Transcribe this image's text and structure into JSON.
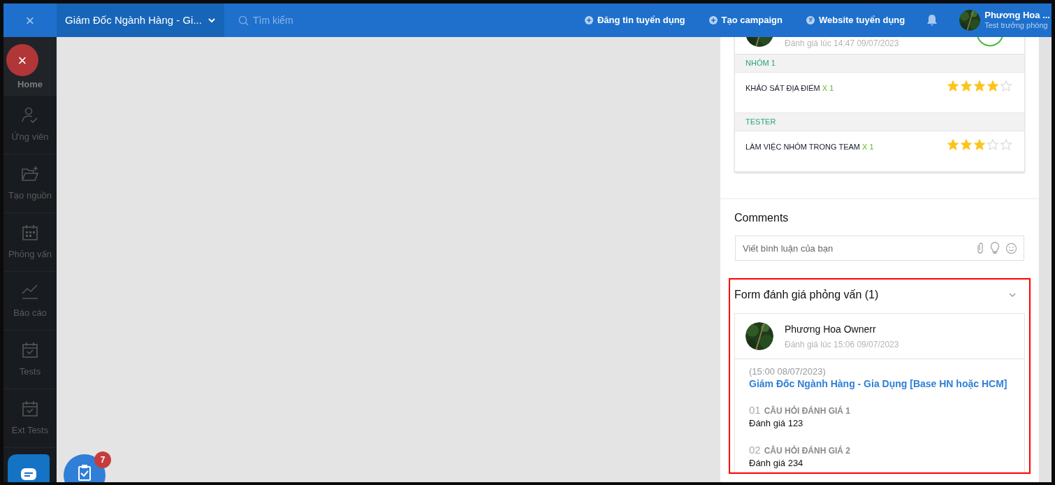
{
  "topbar": {
    "close": "×",
    "job_title": "Giám Đốc Ngành Hàng - Gi...",
    "search": {
      "placeholder": "Tìm kiếm"
    },
    "actions": [
      {
        "label": "Đăng tin tuyển dụng",
        "kind": "plus"
      },
      {
        "label": "Tạo campaign",
        "kind": "plus"
      },
      {
        "label": "Website tuyển dụng",
        "kind": "globe"
      }
    ],
    "user": {
      "name": "Phương Hoa ...",
      "role": "Test trưởng phòng"
    }
  },
  "sidebar": {
    "items": [
      {
        "label": "Home",
        "selected": true
      },
      {
        "label": "Ứng viên",
        "selected": false
      },
      {
        "label": "Tạo nguồn",
        "selected": false
      },
      {
        "label": "Phỏng vấn",
        "selected": false
      },
      {
        "label": "Báo cáo",
        "selected": false
      },
      {
        "label": "Tests",
        "selected": false
      },
      {
        "label": "Ext Tests",
        "selected": false
      }
    ]
  },
  "close_fab": "×",
  "task_badge": "7",
  "review_card": {
    "date": "Đánh giá lúc 14:47 09/07/2023",
    "groups": [
      {
        "name": "NHÓM 1",
        "criteria": [
          {
            "label": "KHẢO SÁT ĐỊA ĐIỂM",
            "weight": "X 1",
            "stars": 4
          }
        ]
      },
      {
        "name": "TESTER",
        "criteria": [
          {
            "label": "LÀM VIỆC NHÓM TRONG TEAM",
            "weight": "X 1",
            "stars": 3
          }
        ]
      }
    ]
  },
  "comments": {
    "title": "Comments",
    "placeholder": "Viết bình luận của bạn"
  },
  "interview_forms": {
    "title": "Form đánh giá phỏng vấn (1)",
    "expanded": true,
    "reviewer": "Phương Hoa Ownerr",
    "reviewed_at": "Đánh giá lúc 15:06 09/07/2023",
    "interview_time": "(15:00 08/07/2023)",
    "job_link": "Giám Đốc Ngành Hàng - Gia Dụng [Base HN hoặc HCM]",
    "questions": [
      {
        "number": "01",
        "title": "CÂU HỎI ĐÁNH GIÁ 1",
        "answer": "Đánh giá 123"
      },
      {
        "number": "02",
        "title": "CÂU HỎI ĐÁNH GIÁ 2",
        "answer": "Đánh giá 234"
      }
    ]
  }
}
